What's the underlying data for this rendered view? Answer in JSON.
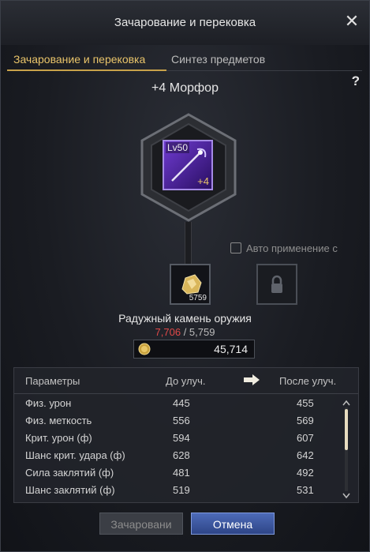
{
  "window": {
    "title": "Зачарование и перековка"
  },
  "tabs": [
    {
      "label": "Зачарование и перековка",
      "active": true
    },
    {
      "label": "Синтез предметов",
      "active": false
    }
  ],
  "help_label": "?",
  "item": {
    "name": "+4 Морфор",
    "level_label": "Lv50",
    "enhance_label": "+4"
  },
  "auto_apply_label": "Авто применение с",
  "material": {
    "stack_count": "5759",
    "name": "Радужный камень оружия",
    "required": "7,706",
    "separator": " / ",
    "owned": "5,759"
  },
  "gold": {
    "value": "45,714"
  },
  "stats": {
    "headers": {
      "name": "Параметры",
      "before": "До улуч.",
      "after": "После улуч."
    },
    "rows": [
      {
        "name": "Физ. урон",
        "before": "445",
        "after": "455"
      },
      {
        "name": "Физ. меткость",
        "before": "556",
        "after": "569"
      },
      {
        "name": "Крит. урон (ф)",
        "before": "594",
        "after": "607"
      },
      {
        "name": "Шанс крит. удара (ф)",
        "before": "628",
        "after": "642"
      },
      {
        "name": "Сила заклятий (ф)",
        "before": "481",
        "after": "492"
      },
      {
        "name": "Шанс заклятий (ф)",
        "before": "519",
        "after": "531"
      }
    ]
  },
  "buttons": {
    "enchant": "Зачаровани",
    "cancel": "Отмена"
  },
  "colors": {
    "accent_gold": "#e9c46a",
    "insufficient_red": "#e04848",
    "primary_blue": "#3d5aa8"
  },
  "icons": {
    "close": "close-icon",
    "coin": "gold-coin-icon",
    "lock": "lock-icon",
    "arrow": "right-arrow-icon",
    "stone": "rainbow-stone-icon",
    "weapon": "staff-icon"
  }
}
